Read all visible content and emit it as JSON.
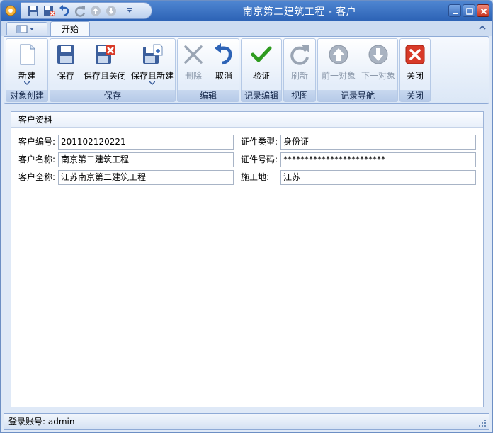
{
  "window": {
    "title": "南京第二建筑工程 - 客户"
  },
  "quick_access": {
    "icons": [
      "save-icon",
      "save-close-icon",
      "undo-icon",
      "refresh-icon",
      "up-icon",
      "down-icon",
      "customize-icon"
    ]
  },
  "tabs": [
    {
      "label": "开始",
      "active": true
    }
  ],
  "ribbon": {
    "groups": [
      {
        "label": "对象创建",
        "buttons": [
          {
            "label": "新建",
            "icon": "new-document-icon",
            "enabled": true,
            "dropdown": true
          }
        ]
      },
      {
        "label": "保存",
        "buttons": [
          {
            "label": "保存",
            "icon": "save-icon",
            "enabled": true
          },
          {
            "label": "保存且关闭",
            "icon": "save-close-icon",
            "enabled": true
          },
          {
            "label": "保存且新建",
            "icon": "save-new-icon",
            "enabled": true,
            "dropdown": true
          }
        ]
      },
      {
        "label": "编辑",
        "buttons": [
          {
            "label": "删除",
            "icon": "delete-x-icon",
            "enabled": false
          },
          {
            "label": "取消",
            "icon": "undo-icon",
            "enabled": true
          }
        ]
      },
      {
        "label": "记录编辑",
        "buttons": [
          {
            "label": "验证",
            "icon": "checkmark-icon",
            "enabled": true
          }
        ]
      },
      {
        "label": "视图",
        "buttons": [
          {
            "label": "刷新",
            "icon": "refresh-icon",
            "enabled": false
          }
        ]
      },
      {
        "label": "记录导航",
        "buttons": [
          {
            "label": "前一对象",
            "icon": "up-arrow-icon",
            "enabled": false
          },
          {
            "label": "下一对象",
            "icon": "down-arrow-icon",
            "enabled": false
          }
        ]
      },
      {
        "label": "关闭",
        "buttons": [
          {
            "label": "关闭",
            "icon": "close-red-icon",
            "enabled": true
          }
        ]
      }
    ]
  },
  "form": {
    "section_title": "客户资料",
    "fields": {
      "customer_code": {
        "label": "客户编号:",
        "value": "201102120221"
      },
      "customer_name": {
        "label": "客户名称:",
        "value": "南京第二建筑工程"
      },
      "customer_fullname": {
        "label": "客户全称:",
        "value": "江苏南京第二建筑工程"
      },
      "id_type": {
        "label": "证件类型:",
        "value": "身份证"
      },
      "id_number": {
        "label": "证件号码:",
        "value": "************************"
      },
      "site": {
        "label": "施工地:",
        "value": "江苏"
      }
    }
  },
  "status": {
    "text": "登录账号: admin"
  },
  "colors": {
    "titlebar": "#3a72c4",
    "ribbon_border": "#8eaad6",
    "accent_green": "#2e9b1f",
    "accent_red": "#d83a28"
  }
}
